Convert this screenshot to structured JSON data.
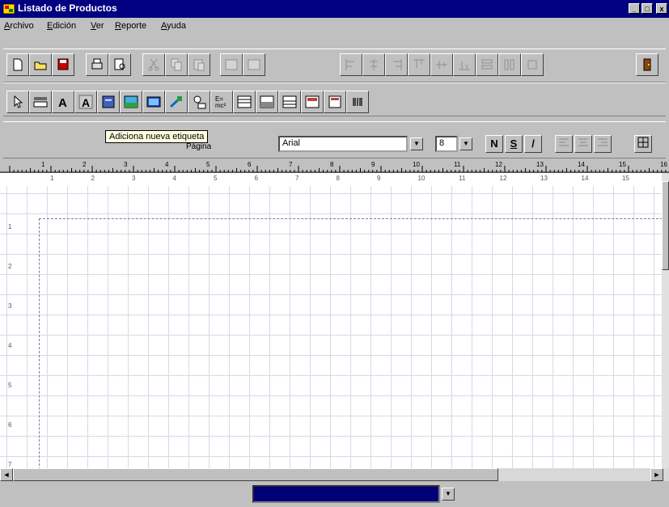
{
  "window": {
    "title": "Listado de Productos",
    "controls": [
      "_",
      "□",
      "x"
    ]
  },
  "menu": [
    {
      "label": "Archivo"
    },
    {
      "label": "Edición"
    },
    {
      "label": "Ver"
    },
    {
      "label": "Reporte"
    },
    {
      "label": "Ayuda"
    }
  ],
  "toolbar1": {
    "buttons": [
      "new-icon",
      "open-icon",
      "save-icon",
      "print-icon",
      "print-preview-icon",
      "cut-icon",
      "copy-icon",
      "paste-icon",
      "copy-format-icon",
      "paste-format-icon",
      "align-left-icon",
      "align-center-icon",
      "align-right-icon",
      "align-top-icon",
      "align-middle-icon",
      "align-bottom-icon",
      "same-width-icon",
      "same-height-icon",
      "same-size-icon",
      "exit-door-icon"
    ]
  },
  "toolbar2": {
    "buttons": [
      "pointer-icon",
      "field-icon",
      "label-text-icon",
      "label-frame-icon",
      "rectangle-icon",
      "picture-icon",
      "image-icon",
      "line-icon",
      "date-icon",
      "formula-icon",
      "header-band-icon",
      "detail-band-icon",
      "footer-band-icon",
      "rtf-icon",
      "memo-icon",
      "barcode-icon"
    ]
  },
  "format": {
    "font": "Arial",
    "size": "8",
    "bold": "N",
    "underline": "S",
    "italic": "/",
    "hidden_label": "Página"
  },
  "tooltip": "Adiciona nueva etiqueta",
  "ruler": {
    "top_marks": [
      "1",
      "2",
      "3",
      "4",
      "5",
      "6",
      "7",
      "8",
      "9",
      "10",
      "11",
      "12",
      "13",
      "14",
      "15",
      "16"
    ],
    "numbers": [
      "1",
      "2",
      "3",
      "4",
      "5",
      "6",
      "7",
      "8",
      "9",
      "10",
      "11",
      "12",
      "13",
      "14",
      "15",
      "16"
    ],
    "side_numbers": [
      "1",
      "2",
      "3",
      "4",
      "5",
      "6",
      "7"
    ]
  },
  "colors": {
    "titlebar": "#000080",
    "status_select": "#00007a",
    "tooltip_bg": "#ffffe1"
  }
}
